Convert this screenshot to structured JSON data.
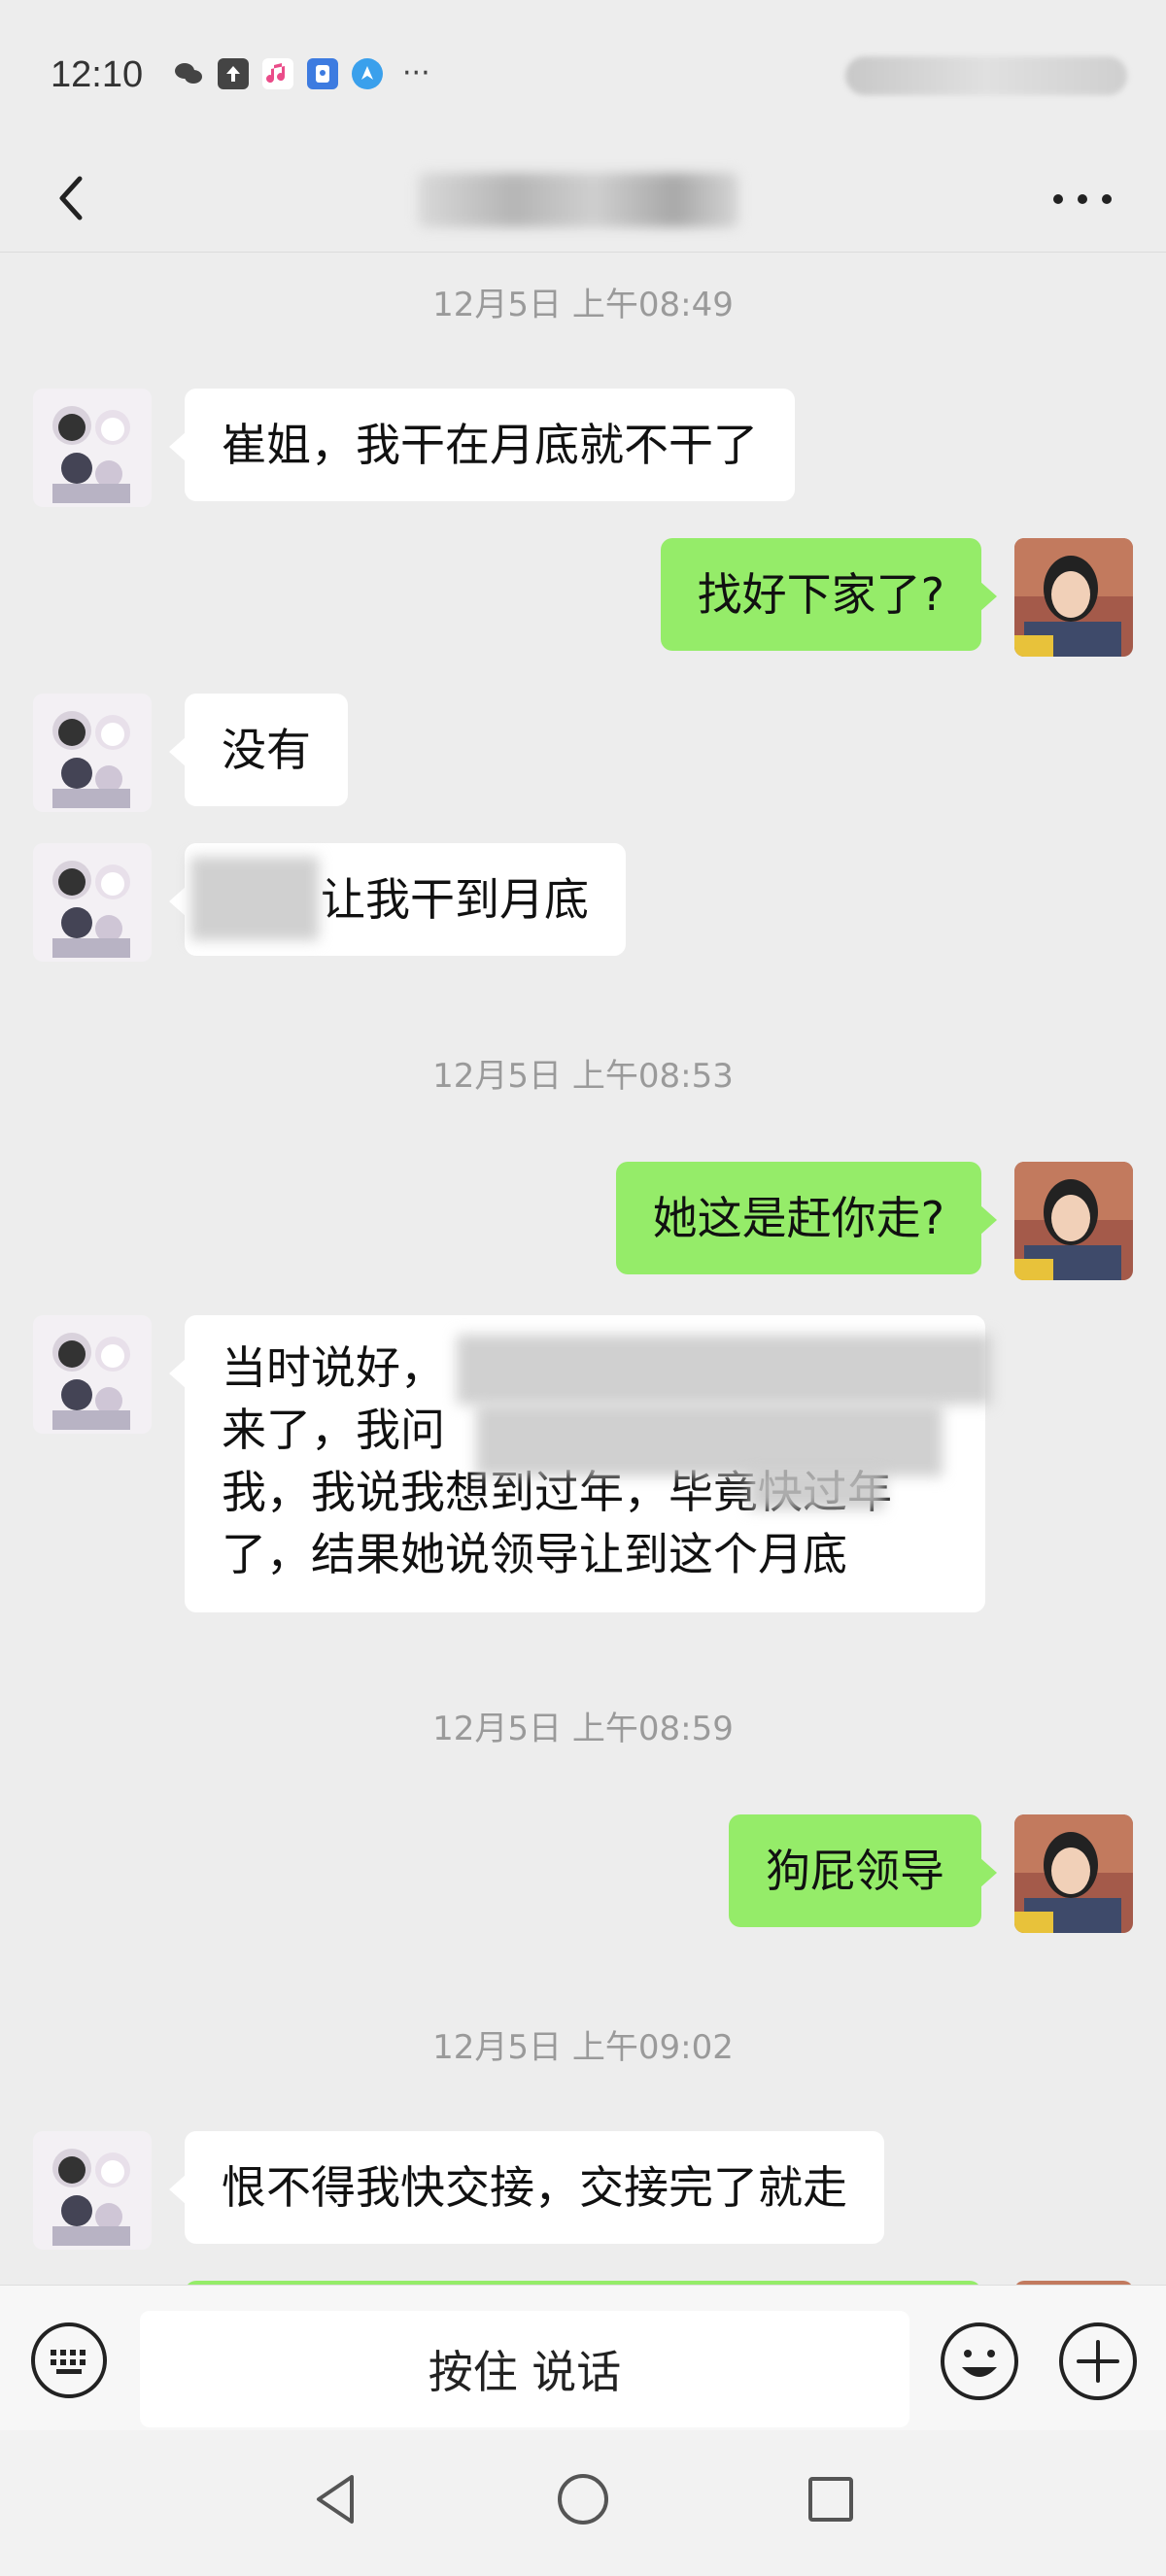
{
  "status_bar": {
    "time": "12:10",
    "icons": [
      "wechat-icon",
      "upload-icon",
      "music-icon",
      "shield-app-icon",
      "compass-app-icon"
    ],
    "more": "···"
  },
  "header": {
    "title": "",
    "back_icon": "chevron-left-icon",
    "more_icon": "ellipsis-icon"
  },
  "messages": [
    {
      "type": "timestamp",
      "text": "12月5日 上午08:49"
    },
    {
      "type": "message",
      "side": "left",
      "text": "崔姐，我干在月底就不干了"
    },
    {
      "type": "message",
      "side": "right",
      "text": "找好下家了?"
    },
    {
      "type": "message",
      "side": "left",
      "text": "没有"
    },
    {
      "type": "message",
      "side": "left",
      "text": "让我干到月底"
    },
    {
      "type": "timestamp",
      "text": "12月5日 上午08:53"
    },
    {
      "type": "message",
      "side": "right",
      "text": "她这是赶你走?"
    },
    {
      "type": "message",
      "side": "left",
      "lines": [
        "当时说好，",
        "来了，我问",
        "我，我说我想到过年，毕竟快过年",
        "了，结果她说领导让到这个月底"
      ]
    },
    {
      "type": "timestamp",
      "text": "12月5日 上午08:59"
    },
    {
      "type": "message",
      "side": "right",
      "text": "狗屁领导"
    },
    {
      "type": "timestamp",
      "text": "12月5日 上午09:02"
    },
    {
      "type": "message",
      "side": "left",
      "text": "恨不得我快交接，交接完了就走"
    }
  ],
  "input_bar": {
    "voice_label": "按住 说话",
    "keyboard_icon": "keyboard-icon",
    "emoji_icon": "emoji-icon",
    "plus_icon": "plus-icon"
  },
  "nav_bar": {
    "icons": [
      "back-triangle-icon",
      "home-circle-icon",
      "recents-square-icon"
    ]
  },
  "colors": {
    "background": "#ededed",
    "bubble_sent": "#95ec69",
    "bubble_received": "#ffffff",
    "timestamp": "#9a9a9a"
  }
}
